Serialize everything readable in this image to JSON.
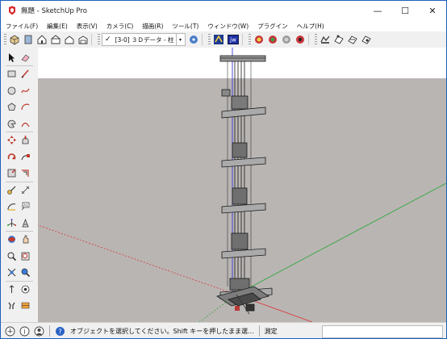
{
  "window": {
    "title": "無題 - SketchUp Pro"
  },
  "window_controls": {
    "minimize": "—",
    "maximize": "☐",
    "close": "✕"
  },
  "menubar": {
    "items": [
      "ファイル(F)",
      "編集(E)",
      "表示(V)",
      "カメラ(C)",
      "描画(R)",
      "ツール(T)",
      "ウィンドウ(W)",
      "プラグイン",
      "ヘルプ(H)"
    ]
  },
  "toolbar": {
    "scene_check": "✓",
    "scene_label": "[3-0] ３Ｄデータ - 柱",
    "scene_arrow": "▾",
    "jw_label": "jw"
  },
  "palette": {
    "icons": [
      "select-arrow-icon",
      "eraser-icon",
      "rectangle-icon",
      "line-pencil-icon",
      "circle-icon",
      "freehand-icon",
      "polygon-icon",
      "arc-icon",
      "pie-icon",
      "arc2-icon",
      "move-icon",
      "push-pull-icon",
      "rotate-icon",
      "follow-me-icon",
      "scale-icon",
      "offset-icon",
      "tape-measure-icon",
      "dimension-icon",
      "protractor-icon",
      "text-icon",
      "axes-icon",
      "3d-text-icon",
      "orbit-icon",
      "pan-icon",
      "zoom-icon",
      "zoom-extents-icon",
      "zoom-window-icon",
      "previous-view-icon",
      "position-camera-icon",
      "look-around-icon",
      "walk-icon",
      "section-plane-icon"
    ]
  },
  "statusbar": {
    "message": "オブジェクトを選択してください。Shift キーを押したまま選...",
    "measure_label": "測定"
  },
  "colors": {
    "axis_blue": "#3b3bd8",
    "axis_green": "#2fa83a",
    "axis_red": "#d83a3a",
    "ground": "#b9b5b3",
    "sky": "#ffffff"
  }
}
